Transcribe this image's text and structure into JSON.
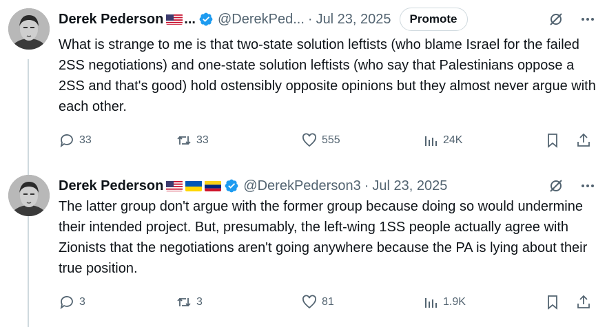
{
  "tweets": [
    {
      "name": "Derek Pederson",
      "handle": "@DerekPed...",
      "name_ellipsis": "...",
      "date": "Jul 23, 2025",
      "promote_label": "Promote",
      "text": "What is strange to me is that two-state solution leftists (who blame Israel for the failed 2SS negotiations) and one-state solution leftists (who say that Palestinians oppose a 2SS and that's good) hold ostensibly opposite opinions but they almost never argue with each other.",
      "replies": "33",
      "retweets": "33",
      "likes": "555",
      "views": "24K"
    },
    {
      "name": "Derek Pederson",
      "handle": "@DerekPederson3",
      "date": "Jul 23, 2025",
      "text": "The latter group don't argue with the former group because doing so would undermine their intended project. But, presumably, the left-wing 1SS people actually agree with Zionists that the negotiations aren't going anywhere because the PA is lying about their true position.",
      "replies": "3",
      "retweets": "3",
      "likes": "81",
      "views": "1.9K"
    }
  ],
  "separator": "·",
  "colors": {
    "verified": "#1d9bf0",
    "muted": "#536471",
    "text": "#0f1419",
    "thread": "#cfd9de"
  },
  "icons": [
    "reply-icon",
    "retweet-icon",
    "like-icon",
    "views-icon",
    "bookmark-icon",
    "share-icon",
    "grok-icon",
    "more-icon",
    "verified-icon"
  ]
}
